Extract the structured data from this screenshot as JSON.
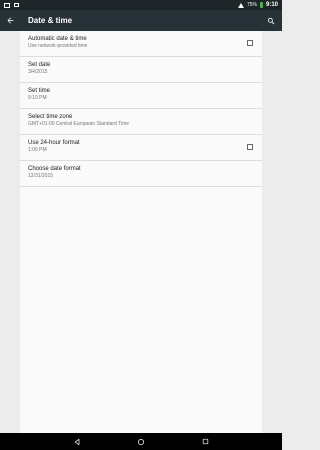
{
  "status_bar": {
    "battery_percent": "75%",
    "time": "9:10"
  },
  "toolbar": {
    "title": "Date & time",
    "back_icon": "back-arrow-icon",
    "search_icon": "search-icon"
  },
  "settings": [
    {
      "title": "Automatic date & time",
      "subtitle": "Use network-provided time",
      "has_checkbox": true,
      "checked": false
    },
    {
      "title": "Set date",
      "subtitle": "3/4/2015",
      "has_checkbox": false
    },
    {
      "title": "Set time",
      "subtitle": "9:10 PM",
      "has_checkbox": false
    },
    {
      "title": "Select time zone",
      "subtitle": "GMT+01:00 Central European Standard Time",
      "has_checkbox": false
    },
    {
      "title": "Use 24-hour format",
      "subtitle": "1:00 PM",
      "has_checkbox": true,
      "checked": false
    },
    {
      "title": "Choose date format",
      "subtitle": "12/31/2015",
      "has_checkbox": false
    }
  ],
  "nav": {
    "back_icon": "triangle-back-icon",
    "home_icon": "circle-home-icon",
    "recents_icon": "square-recents-icon"
  },
  "colors": {
    "toolbar": "#263238",
    "status_bar": "#1f2629",
    "background": "#ececec",
    "card": "#fafafa"
  }
}
